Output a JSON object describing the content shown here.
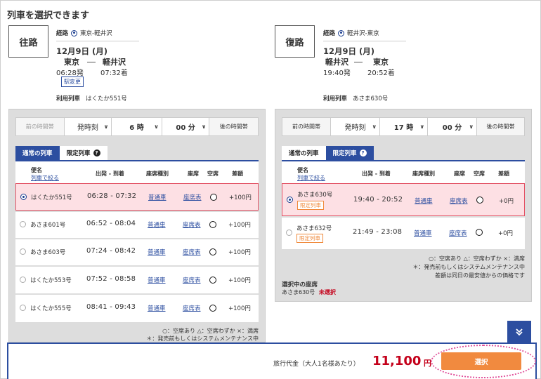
{
  "title": "列車を選択できます",
  "outbound": {
    "leg_label": "往路",
    "route_label": "経路",
    "route_value": "東京-軽井沢",
    "date": "12月9日 (月)",
    "from": "東京",
    "to": "軽井沢",
    "dep_time": "06:28発",
    "arr_time": "07:32着",
    "change_station_btn": "駅変更",
    "train_label": "利用列車",
    "train_value": "はくたか551号",
    "timebar": {
      "prev": "前の時間帯",
      "mode": "発時刻",
      "hour": "6 時",
      "minute": "00 分",
      "next": "後の時間帯"
    },
    "tab_normal": "通常の列車",
    "tab_limited": "限定列車",
    "headers": {
      "name": "便名",
      "sort": "列車で絞る",
      "time": "出発 - 到着",
      "seat_type": "座席種別",
      "seat": "座席",
      "vacancy": "空席",
      "diff": "差額"
    },
    "rows": [
      {
        "name": "はくたか551号",
        "time": "06:28 - 07:32",
        "seat_type": "普通車",
        "seat": "座席表",
        "diff": "+100円"
      },
      {
        "name": "あさま601号",
        "time": "06:52 - 08:04",
        "seat_type": "普通車",
        "seat": "座席表",
        "diff": "+100円"
      },
      {
        "name": "あさま603号",
        "time": "07:24 - 08:42",
        "seat_type": "普通車",
        "seat": "座席表",
        "diff": "+100円"
      },
      {
        "name": "はくたか553号",
        "time": "07:52 - 08:58",
        "seat_type": "普通車",
        "seat": "座席表",
        "diff": "+100円"
      },
      {
        "name": "はくたか555号",
        "time": "08:41 - 09:43",
        "seat_type": "普通車",
        "seat": "座席表",
        "diff": "+100円"
      }
    ],
    "note1": "○：空席あり △：空席わずか ×：満席",
    "note2": "＊：発売前もしくはシステムメンテナンス中"
  },
  "return": {
    "leg_label": "復路",
    "route_label": "経路",
    "route_value": "軽井沢-東京",
    "date": "12月9日 (月)",
    "from": "軽井沢",
    "to": "東京",
    "dep_time": "19:40発",
    "arr_time": "20:52着",
    "train_label": "利用列車",
    "train_value": "あさま630号",
    "timebar": {
      "prev": "前の時間帯",
      "mode": "発時刻",
      "hour": "17 時",
      "minute": "00 分",
      "next": "後の時間帯"
    },
    "tab_normal": "通常の列車",
    "tab_limited": "限定列車",
    "headers": {
      "name": "便名",
      "sort": "列車で絞る",
      "time": "出発 - 到着",
      "seat_type": "座席種別",
      "seat": "座席",
      "vacancy": "空席",
      "diff": "差額"
    },
    "rows": [
      {
        "name": "あさま630号",
        "badge": "限定列車",
        "time": "19:40 - 20:52",
        "seat_type": "普通車",
        "seat": "座席表",
        "diff": "+0円"
      },
      {
        "name": "あさま632号",
        "badge": "限定列車",
        "time": "21:49 - 23:08",
        "seat_type": "普通車",
        "seat": "座席表",
        "diff": "+0円"
      }
    ],
    "note1": "○：空席あり △：空席わずか ×：満席",
    "note2": "＊：発売前もしくはシステムメンテナンス中",
    "note3": "差額は同日の最安値からの価格です",
    "selected_seat_title": "選択中の座席",
    "selected_seat_train": "あさま630号",
    "selected_seat_status": "未選択"
  },
  "footer": {
    "price_label": "旅行代金（大人1名様あたり）",
    "price": "11,100",
    "price_unit": "円",
    "select_button": "選択"
  },
  "scroll_icon": "double-chevron-down-icon"
}
